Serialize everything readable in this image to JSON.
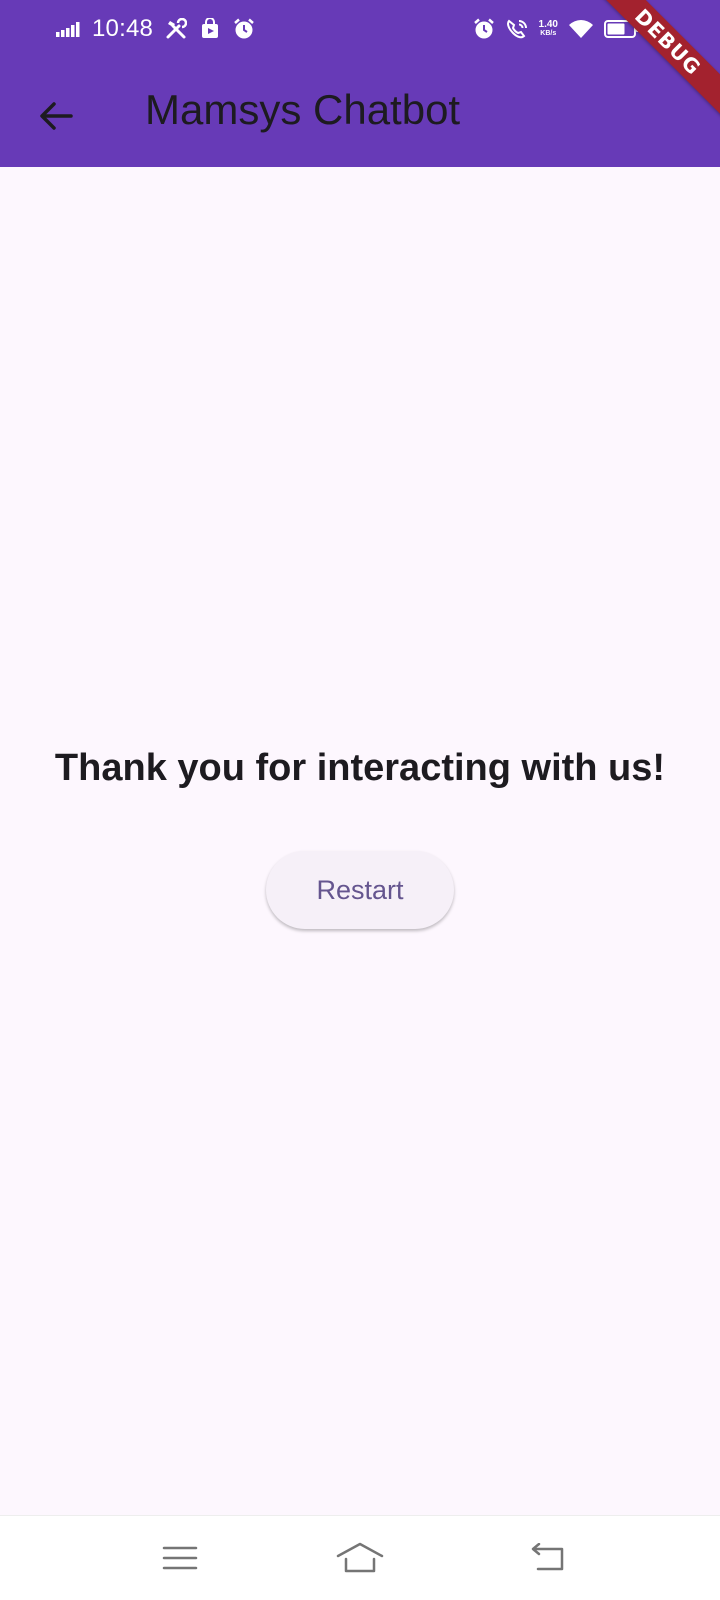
{
  "status_bar": {
    "time": "10:48",
    "net_speed_value": "1.40",
    "net_speed_unit": "KB/s",
    "battery": "62",
    "icons": [
      "signal-icon",
      "tools-icon",
      "store-icon",
      "alarm-icon",
      "alarm-icon",
      "wifi-call-icon",
      "wifi-icon",
      "battery-icon"
    ]
  },
  "app_bar": {
    "title": "Mamsys Chatbot",
    "back_icon": "arrow-back-icon",
    "background_color": "#673ab7"
  },
  "debug_banner": {
    "label": "DEBUG"
  },
  "main": {
    "message": "Thank you for interacting with us!",
    "restart_label": "Restart"
  },
  "nav_bar": {
    "items": [
      "menu-icon",
      "home-icon",
      "back-icon"
    ]
  },
  "colors": {
    "accent": "#673ab7",
    "background": "#fdf7fe",
    "button_text": "#65558f",
    "debug": "#a3222e"
  }
}
